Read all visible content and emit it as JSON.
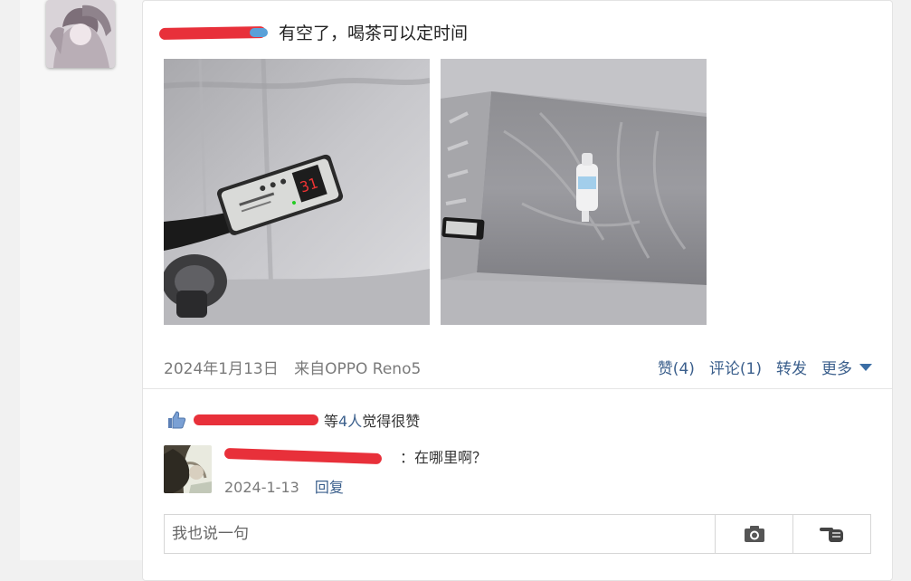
{
  "post": {
    "text": "有空了，喝茶可以定时间",
    "date": "2024年1月13日",
    "source": "来自OPPO Reno5"
  },
  "actions": {
    "like": "赞(4)",
    "comment": "评论(1)",
    "share": "转发",
    "more": "更多"
  },
  "likes": {
    "suffix": "等",
    "count": "4人",
    "text": "觉得很赞"
  },
  "comment": {
    "text": "：在哪里啊？",
    "date": "2024-1-13",
    "reply": "回复"
  },
  "reply_box": {
    "placeholder": "我也说一句"
  },
  "colors": {
    "link": "#3b5f8c",
    "redaction": "#e8303a"
  },
  "icons": [
    "thumbs-up-icon",
    "camera-icon",
    "pointing-hand-icon",
    "triangle-down-icon"
  ]
}
